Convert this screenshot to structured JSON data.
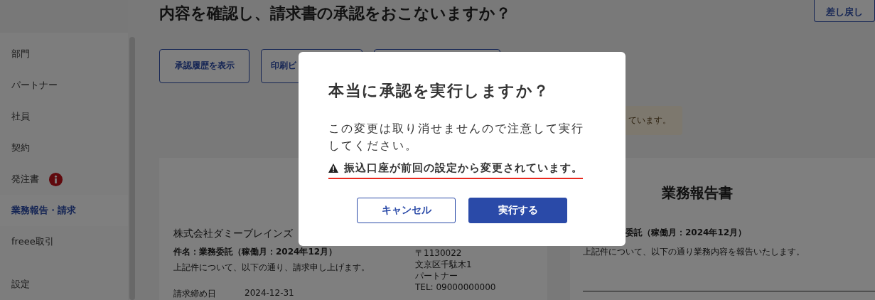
{
  "sidebar": {
    "items": [
      {
        "label": "部門",
        "selected": false,
        "alert": false
      },
      {
        "label": "パートナー",
        "selected": false,
        "alert": false
      },
      {
        "label": "社員",
        "selected": false,
        "alert": false
      },
      {
        "label": "契約",
        "selected": false,
        "alert": false
      },
      {
        "label": "発注書",
        "selected": false,
        "alert": true
      },
      {
        "label": "業務報告・請求",
        "selected": true,
        "alert": false
      },
      {
        "label": "freee取引",
        "selected": false,
        "alert": false
      },
      {
        "label": "設定",
        "selected": false,
        "alert": false
      }
    ]
  },
  "page": {
    "title": "内容を確認し、請求書の承認をおこないますか？",
    "return_button": "差し戻し",
    "actions": [
      "承認履歴を表示",
      "印刷ビ"
    ],
    "notice": "ています。"
  },
  "invoice": {
    "recipient": "株式会社ダミーブレインズ",
    "subject": "件名：業務委託（稼働月：2024年12月）",
    "lead": "上記件について、以下の通り、請求申し上げます。",
    "fields": [
      {
        "label": "請求締め日",
        "value": "2024-12-31"
      }
    ],
    "sender": [
      "〒1130022",
      "文京区千駄木1",
      "パートナー",
      "TEL: 09000000000"
    ]
  },
  "report": {
    "title": "業務報告書",
    "subject": "委託（稼働月：2024年12月）",
    "lead": "上記件について、以下の通り業務内容を報告いたします。"
  },
  "dialog": {
    "title": "本当に承認を実行しますか？",
    "message": "この変更は取り消せませんので注意して実行してください。",
    "warning": "振込口座が前回の設定から変更されています。",
    "cancel": "キャンセル",
    "confirm": "実行する"
  }
}
